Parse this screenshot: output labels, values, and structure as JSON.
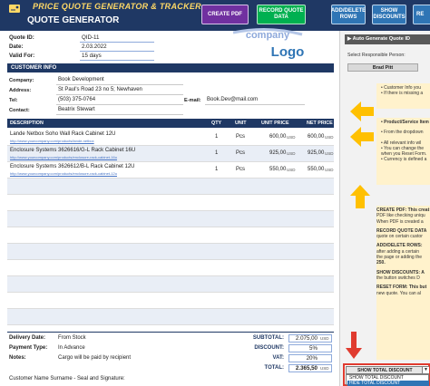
{
  "header": {
    "app_title": "PRICE QUOTE GENERATOR & TRACKER",
    "doc_title": "QUOTE GENERATOR",
    "buttons": {
      "create_pdf": "CREATE PDF",
      "record_line1": "RECORD QUOTE",
      "record_line2": "DATA",
      "add_delete_line1": "ADD/DELETE",
      "add_delete_line2": "ROWS",
      "show_discounts_line1": "SHOW",
      "show_discounts_line2": "DISCOUNTS",
      "reset_partial": "RE"
    }
  },
  "quote": {
    "id_label": "Quote ID:",
    "id_value": "QID-11",
    "date_label": "Date:",
    "date_value": "2.03.2022",
    "valid_label": "Valid For:",
    "valid_value": "15 days"
  },
  "logo": {
    "line1": "company",
    "line2": "Logo"
  },
  "customer": {
    "header": "CUSTOMER INFO",
    "company_label": "Company:",
    "company_value": "Book Development",
    "address_label": "Address:",
    "address_value": "St Paul's Road 23 no 5; Newhaven",
    "tel_label": "Tel:",
    "tel_value": "(503) 375-0764",
    "email_label": "E-mail:",
    "email_value": "Book.Dev@mail.com",
    "contact_label": "Contact:",
    "contact_value": "Beatrix Stewart"
  },
  "table": {
    "headers": {
      "description": "DESCRIPTION",
      "qty": "QTY",
      "unit": "UNIT",
      "unit_price": "UNIT PRICE",
      "net_price": "NET PRICE"
    },
    "currency": "USD",
    "rows": [
      {
        "name": "Lande Netbox Soho Wall Rack Cabinet 12U",
        "link": "http://www.yourcompany.com/products/lande-netbox",
        "qty": "1",
        "unit": "Pcs",
        "unit_price": "600,00",
        "net_price": "600,00"
      },
      {
        "name": "Enclosure Systems 3626616/G-L Rack Cabinet 16U",
        "link": "http://www.yourcompany.com/products/enclosure-rack-cabinet-16u",
        "qty": "1",
        "unit": "Pcs",
        "unit_price": "925,00",
        "net_price": "925,00"
      },
      {
        "name": "Enclosure Systems 3626612/B-L Rack Cabinet 12U",
        "link": "http://www.yourcompany.com/products/enclosure-rack-cabinet-12u",
        "qty": "1",
        "unit": "Pcs",
        "unit_price": "550,00",
        "net_price": "550,00"
      }
    ]
  },
  "footer": {
    "delivery_label": "Delivery Date:",
    "delivery_value": "From Stock",
    "payment_label": "Payment Type:",
    "payment_value": "In Advance",
    "notes_label": "Notes:",
    "notes_value": "Cargo will be paid by recipient",
    "signature_label": "Customer Name Surname - Seal and Signature:",
    "subtotal_label": "SUBTOTAL:",
    "subtotal_value": "2.075,00",
    "discount_label": "DISCOUNT:",
    "discount_value": "5%",
    "vat_label": "VAT:",
    "vat_value": "20%",
    "total_label": "TOTAL:",
    "total_value": "2.365,50",
    "currency": "USD"
  },
  "panel": {
    "auto_generate": "▶ Auto Generate Quote ID",
    "select_label": "Select Responsible Person:",
    "person": "Brad Pitt",
    "note1": [
      "• Customer Info you",
      "• If there is missing a"
    ],
    "note2": [
      "• Product/Service Item",
      "• From the dropdown",
      "• All relevant info wil",
      "• You can change the",
      "  when you Reset Form.",
      "• Currency is defined a"
    ],
    "note3": [
      "CREATE PDF: This creat",
      "PDF like checking uniqu",
      "When PDF is created a",
      "",
      "RECORD QUOTE DATA",
      "quote on certain custor",
      "",
      "ADD/DELETE ROWS:",
      "after adding a certain",
      "the page or adding the",
      "250.",
      "",
      "SHOW DISCOUNTS: A",
      "the button switches D",
      "",
      "RESET FORM: This but",
      "new quote. You can al"
    ],
    "dropdown_selected": "SHOW TOTAL DISCOUNT",
    "dropdown_options": [
      "SHOW TOTAL DISCOUNT",
      "HIDE TOTAL DISCOUNT"
    ]
  },
  "colors": {
    "navy": "#1f3864",
    "purple": "#7030a0",
    "green": "#00b050",
    "blue": "#2f75b5",
    "note_yellow": "#fff2cc",
    "arrow_orange": "#ffc000",
    "alert_red": "#e03b2f"
  }
}
